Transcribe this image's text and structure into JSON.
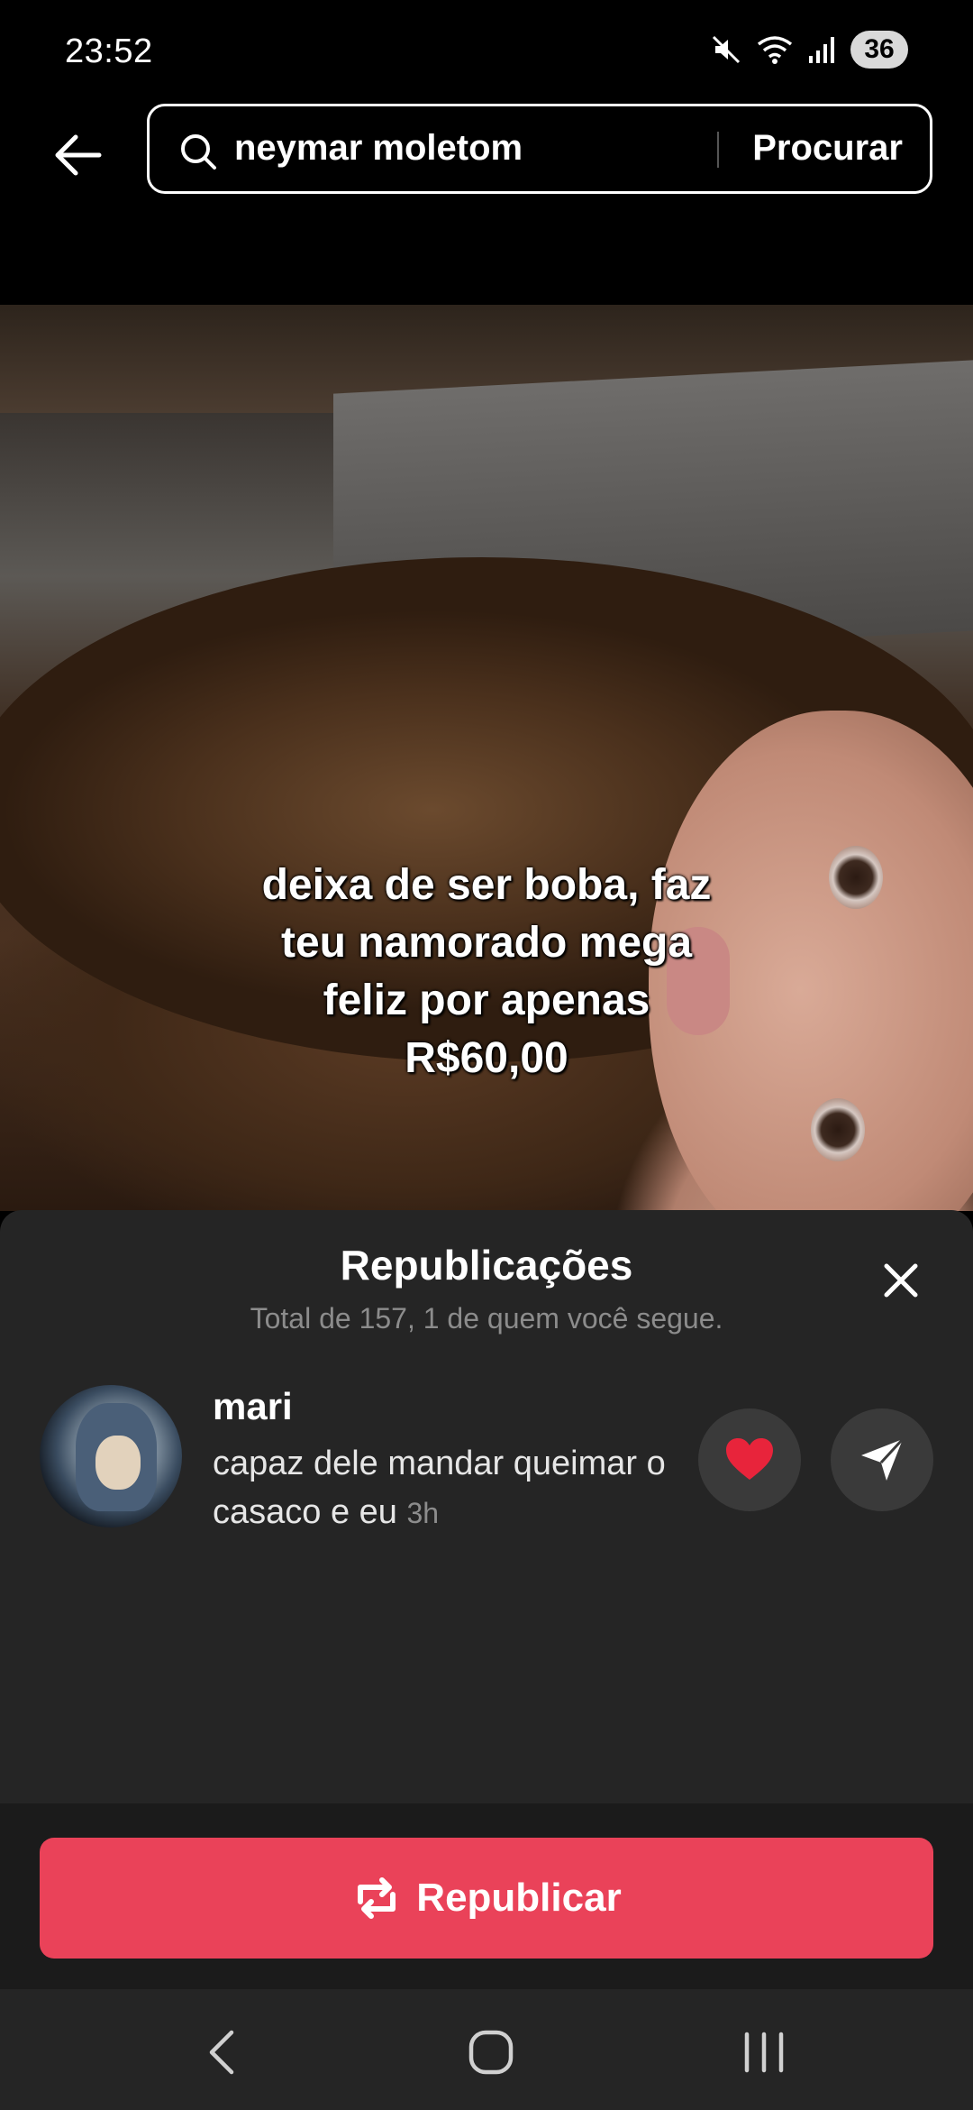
{
  "status_bar": {
    "time": "23:52",
    "battery": "36"
  },
  "search": {
    "query": "neymar moletom",
    "button_label": "Procurar"
  },
  "video": {
    "caption_lines": [
      "deixa de ser boba, faz",
      "teu namorado mega",
      "feliz por apenas",
      "R$60,00"
    ]
  },
  "sheet": {
    "title": "Republicações",
    "subtitle": "Total de 157, 1 de quem você segue.",
    "repost": {
      "username": "mari",
      "comment": "capaz dele mandar queimar o casaco e eu",
      "time": "3h"
    }
  },
  "actions": {
    "repost_label": "Republicar"
  },
  "colors": {
    "accent": "#ea4259",
    "sheet_bg": "#252525",
    "like_red": "#e8243b"
  },
  "icons": [
    "back-arrow-icon",
    "search-icon",
    "close-icon",
    "heart-icon",
    "send-icon",
    "repost-icon",
    "mute-icon",
    "wifi-icon",
    "signal-icon"
  ]
}
